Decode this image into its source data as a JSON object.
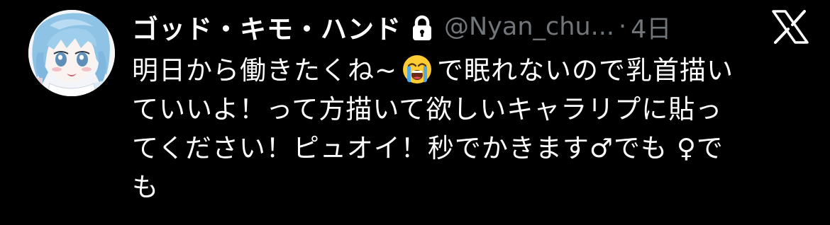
{
  "tweet": {
    "display_name": "ゴッド・キモ・ハンド",
    "handle": "@Nyan_chu...",
    "separator": "·",
    "timestamp": "4日",
    "locked_icon": "lock-icon",
    "platform_icon": "x-logo-icon",
    "avatar_icon": "avatar-illustration",
    "text_lines": {
      "line1_before_emoji": "明日から働きたくね~",
      "line1_emoji": "loudly-crying-face-emoji",
      "line1_after_emoji": "で眠れないので乳首描い",
      "line2": "ていいよ！って方描いて欲しいキャラリプに貼っ",
      "line3": "てください！ピュオイ！秒でかきます♂でも ♀で",
      "line4": "も"
    }
  },
  "colors": {
    "background": "#000000",
    "text_primary": "#ffffff",
    "text_secondary": "#71767b"
  }
}
